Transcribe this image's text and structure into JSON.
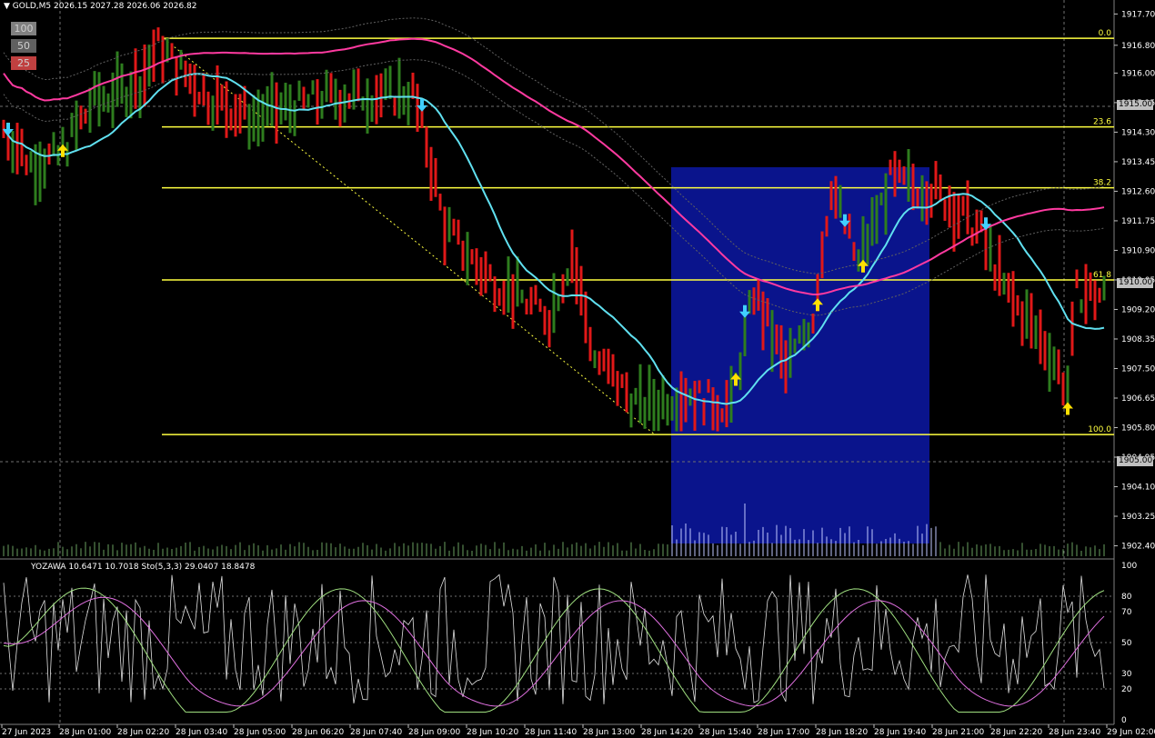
{
  "header": {
    "symbol_label": "GOLD,M5",
    "ohlc": "2026.15 2027.28 2026.06 2026.82",
    "menu_glyph": "▼"
  },
  "timeframe_buttons": [
    {
      "label": "100",
      "color": "#808080"
    },
    {
      "label": "50",
      "color": "#606060"
    },
    {
      "label": "25",
      "color": "#c04040"
    }
  ],
  "indicator_header": "YOZAWA 10.6471 10.7018  Sto(5,3,3) 29.0407 18.8478",
  "price_scale": [
    "1917.70",
    "1916.80",
    "1916.00",
    "1915.15",
    "1914.30",
    "1913.45",
    "1912.60",
    "1911.75",
    "1910.90",
    "1910.05",
    "1909.20",
    "1908.35",
    "1907.50",
    "1906.65",
    "1905.80",
    "1904.95",
    "1904.10",
    "1903.25",
    "1902.40"
  ],
  "price_boxes": [
    {
      "label": "1915.00",
      "color": "#c8c8c8"
    },
    {
      "label": "1910.00",
      "color": "#c8c8c8"
    },
    {
      "label": "1905.00",
      "color": "#c8c8c8"
    }
  ],
  "fib_levels": [
    {
      "label": "0.0",
      "price": 1917.0
    },
    {
      "label": "23.6",
      "price": 1914.45
    },
    {
      "label": "38.2",
      "price": 1912.7
    },
    {
      "label": "61.8",
      "price": 1910.05
    },
    {
      "label": "100.0",
      "price": 1905.6
    }
  ],
  "oscillator_scale": [
    "100",
    "80",
    "70",
    "50",
    "30",
    "20",
    "0"
  ],
  "time_axis": [
    "27 Jun 2023",
    "28 Jun 01:00",
    "28 Jun 02:20",
    "28 Jun 03:40",
    "28 Jun 05:00",
    "28 Jun 06:20",
    "28 Jun 07:40",
    "28 Jun 09:00",
    "28 Jun 10:20",
    "28 Jun 11:40",
    "28 Jun 13:00",
    "28 Jun 14:20",
    "28 Jun 15:40",
    "28 Jun 17:00",
    "28 Jun 18:20",
    "28 Jun 19:40",
    "28 Jun 21:00",
    "28 Jun 22:20",
    "28 Jun 23:40",
    "29 Jun 02:00"
  ],
  "colors": {
    "background": "#000000",
    "bull": "#2e7d1e",
    "bear": "#e01818",
    "fib": "#ffff40",
    "ma_fast": "#60e0f0",
    "ma_slow": "#ff3aa0",
    "zone": "#0a148c",
    "arrow_up": "#ffe000",
    "arrow_down": "#40d0ff"
  },
  "signal_arrows": [
    {
      "type": "down",
      "x_index": 1
    },
    {
      "type": "up",
      "x_index": 13
    },
    {
      "type": "down",
      "x_index": 92
    },
    {
      "type": "up",
      "x_index": 161
    },
    {
      "type": "down",
      "x_index": 163
    },
    {
      "type": "up",
      "x_index": 179
    },
    {
      "type": "down",
      "x_index": 185
    },
    {
      "type": "up",
      "x_index": 189
    },
    {
      "type": "down",
      "x_index": 216
    },
    {
      "type": "up",
      "x_index": 234
    }
  ]
}
